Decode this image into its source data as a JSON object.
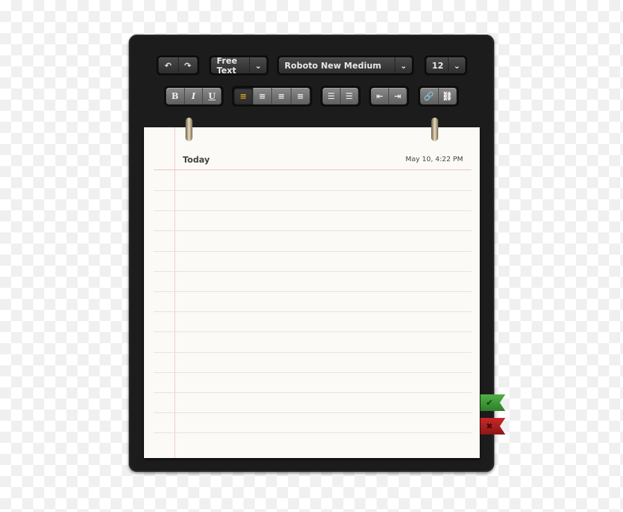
{
  "toolbar": {
    "undo_icon": "↶",
    "redo_icon": "↷",
    "style_label": "Free Text",
    "font_label": "Roboto New Medium",
    "size_label": "12",
    "chevron": "⌄",
    "bold": "B",
    "italic": "I",
    "underline": "U",
    "align_left": "≡",
    "align_center": "≡",
    "align_right": "≡",
    "justify": "≡",
    "bullets": "☰",
    "numbered": "☰",
    "outdent": "⇤",
    "indent": "⇥",
    "link": "🔗",
    "unlink": "⛓"
  },
  "note": {
    "title": "Today",
    "datetime": "May 10, 4:22 PM"
  },
  "flags": {
    "confirm": "✔",
    "cancel": "✖",
    "confirm_color": "#3f9a3a",
    "cancel_color": "#b02020"
  }
}
